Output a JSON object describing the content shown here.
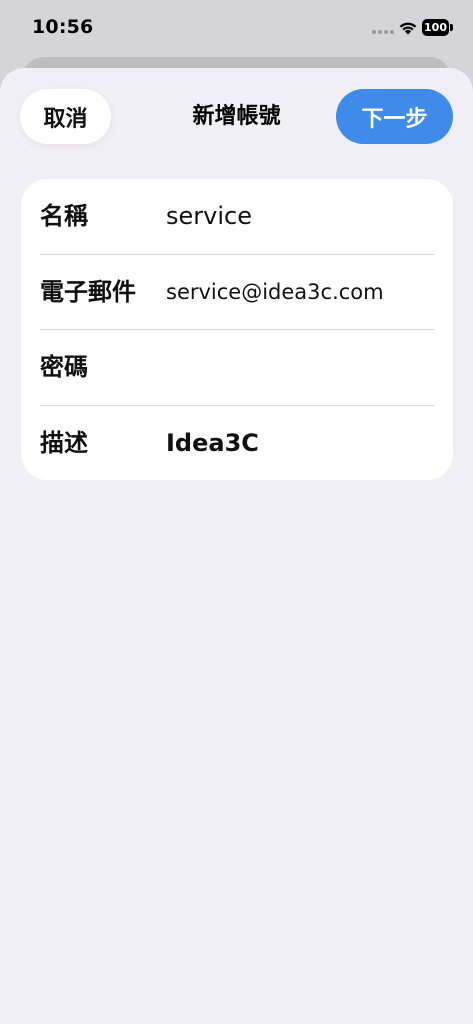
{
  "status_bar": {
    "time": "10:56",
    "battery": "100"
  },
  "header": {
    "cancel_label": "取消",
    "title": "新增帳號",
    "next_label": "下一步"
  },
  "form": {
    "rows": [
      {
        "label": "名稱",
        "value": "service"
      },
      {
        "label": "電子郵件",
        "value": "service@idea3c.com"
      },
      {
        "label": "密碼",
        "value": ""
      },
      {
        "label": "描述",
        "value": "Idea3C"
      }
    ]
  },
  "colors": {
    "accent": "#3e8bea",
    "sheet_bg": "#f0eff5",
    "card_bg": "#ffffff"
  }
}
